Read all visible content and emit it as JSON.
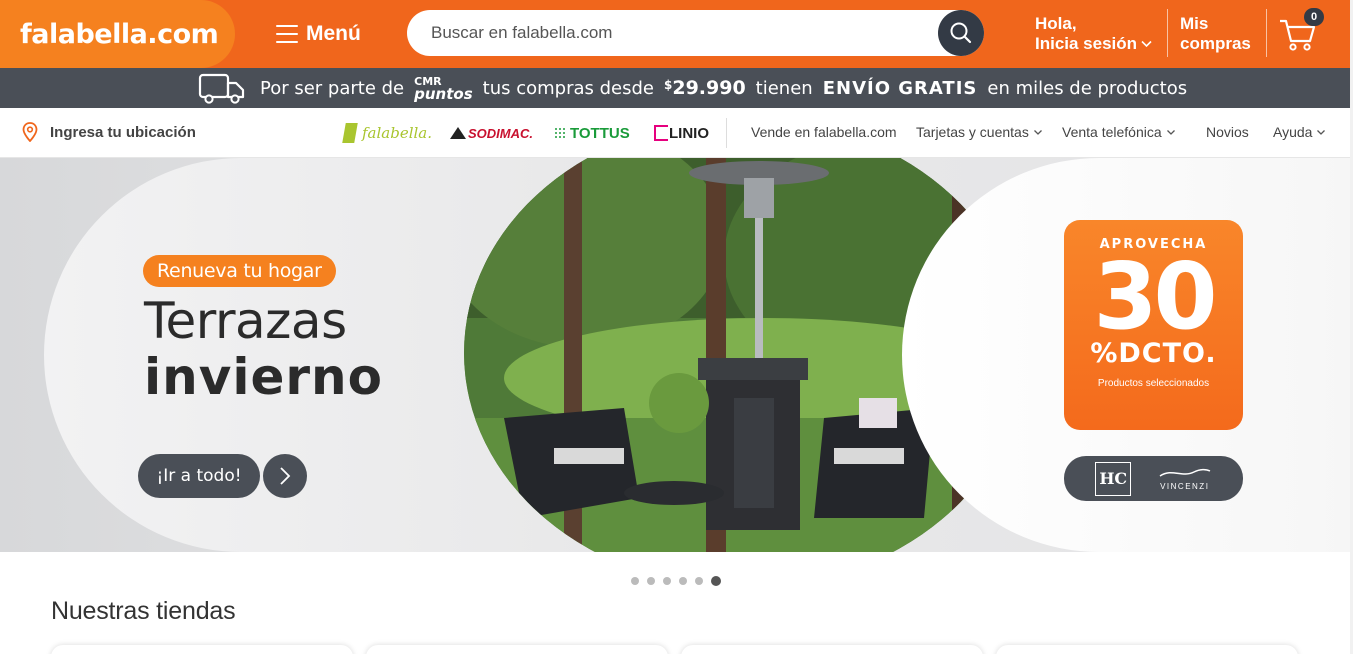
{
  "header": {
    "logo": "falabella.com",
    "menu_label": "Menú",
    "search_placeholder": "Buscar en falabella.com",
    "greeting_line1": "Hola,",
    "greeting_line2": "Inicia sesión",
    "purchases_line1": "Mis",
    "purchases_line2": "compras",
    "cart_count": "0",
    "brand_color": "#f0661c"
  },
  "promo_bar": {
    "text_before": "Por ser parte de",
    "cmr_line1": "CMR",
    "cmr_line2": "puntos",
    "text_middle": "tus compras desde",
    "price_symbol": "$",
    "price": "29.990",
    "text_have": "tienen",
    "highlight": "ENVÍO GRATIS",
    "text_after": "en miles de productos"
  },
  "navbar": {
    "location": "Ingresa tu ubicación",
    "brands": [
      "falabella.",
      "SODIMAC.",
      "TOTTUS",
      "LINIO"
    ],
    "links": [
      "Vende en falabella.com",
      "Tarjetas y cuentas",
      "Venta telefónica",
      "Novios",
      "Ayuda"
    ]
  },
  "hero": {
    "tag": "Renueva tu hogar",
    "title_line1": "Terrazas",
    "title_line2": "invierno",
    "cta": "¡Ir a todo!",
    "offer_top": "APROVECHA",
    "offer_number": "30",
    "offer_unit": "%DCTO.",
    "offer_note": "Productos seleccionados",
    "brand_hc": "HC",
    "brand_vincenzi": "VINCENZI"
  },
  "carousel": {
    "total_slides": 6,
    "active_index": 5
  },
  "section": {
    "title": "Nuestras tiendas"
  }
}
